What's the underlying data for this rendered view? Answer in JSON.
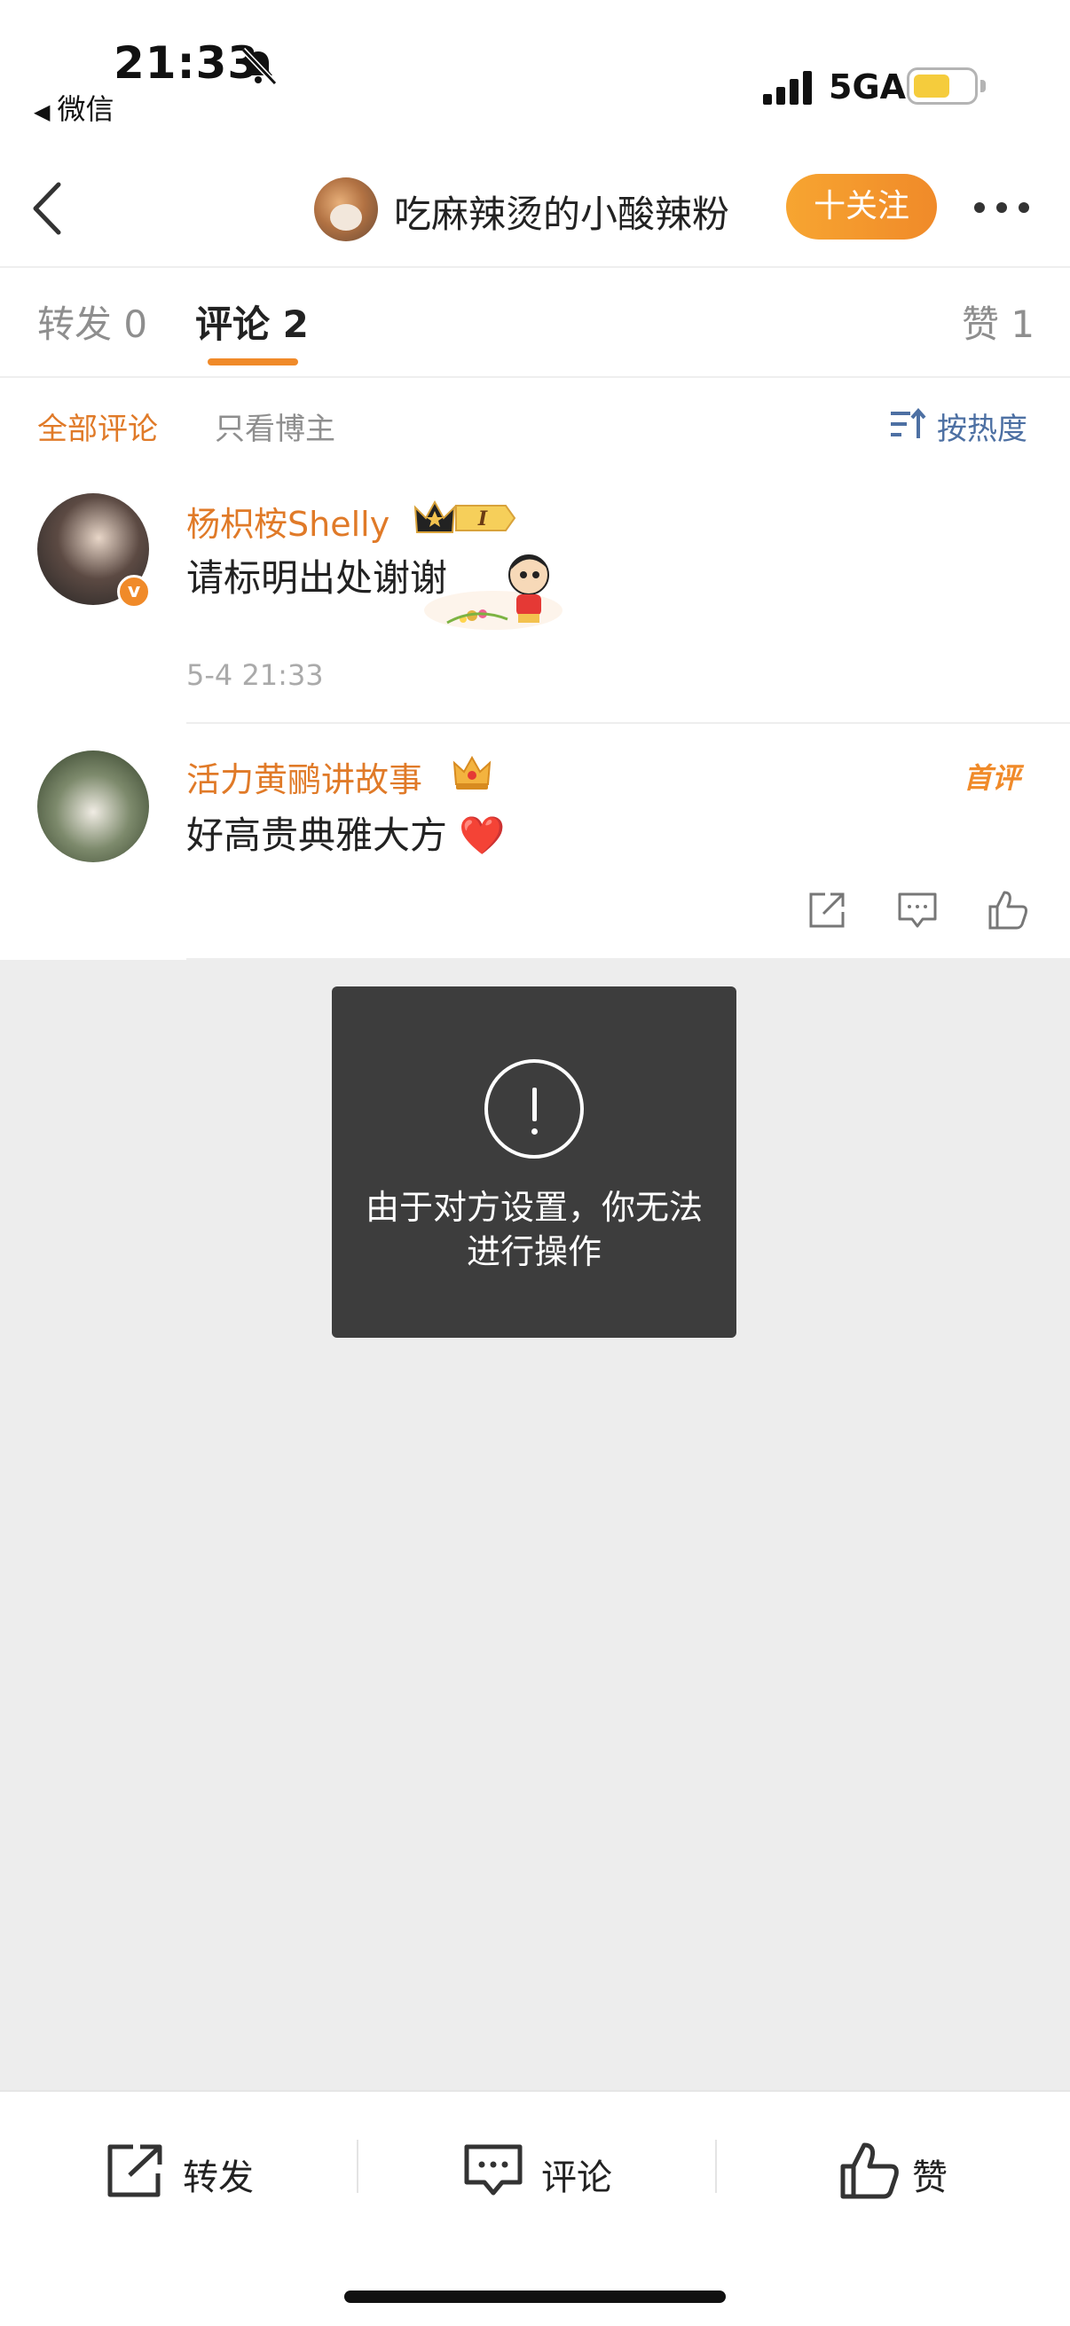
{
  "status_bar": {
    "time": "21:33",
    "back_app": "微信",
    "network": "5GA",
    "battery_color": "#f5cc3c"
  },
  "nav": {
    "title": "吃麻辣烫的小酸辣粉",
    "follow_label": "十关注"
  },
  "tabs": [
    {
      "label": "转发 0"
    },
    {
      "label": "评论 2"
    },
    {
      "label": "赞 1"
    }
  ],
  "filters": {
    "all": "全部评论",
    "author_only": "只看博主",
    "sort": "按热度"
  },
  "comments": [
    {
      "name": "杨枳桉Shelly",
      "badge_text": "I",
      "text": "请标明出处谢谢",
      "time": "5-4 21:33"
    },
    {
      "name": "活力黄鹂讲故事",
      "tag": "首评",
      "text": "好高贵典雅大方 ❤️"
    }
  ],
  "toast": {
    "message": "由于对方设置，你无法进行操作"
  },
  "toolbar": {
    "repost_label": "转发",
    "comment_label": "评论",
    "like_label": "赞"
  },
  "colors": {
    "accent": "#f08a29",
    "name_orange": "#e07a28",
    "link_blue": "#4d70a3",
    "toast_bg": "#3d3d3d"
  }
}
